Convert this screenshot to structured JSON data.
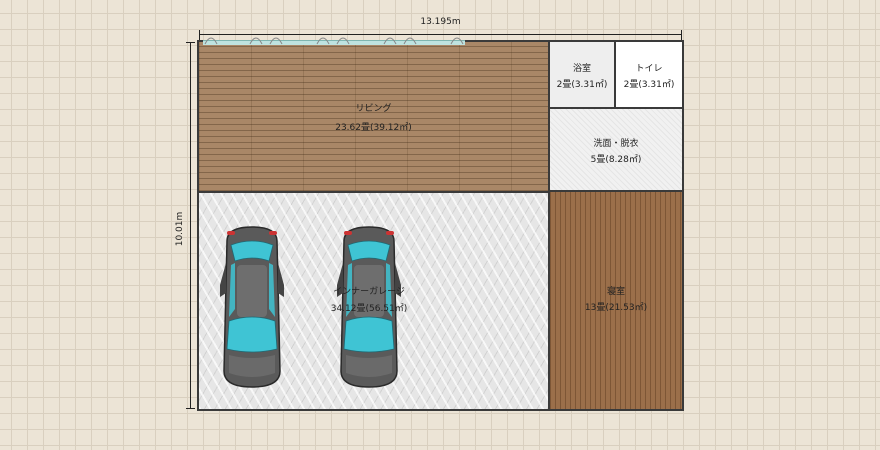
{
  "dimensions": {
    "width_label": "13.195m",
    "height_label": "10.01m"
  },
  "rooms": {
    "living": {
      "name": "リビング",
      "area": "23.62畳(39.12㎡)"
    },
    "bath": {
      "name": "浴室",
      "area": "2畳(3.31㎡)"
    },
    "toilet": {
      "name": "トイレ",
      "area": "2畳(3.31㎡)"
    },
    "washroom": {
      "name": "洗面・脱衣",
      "area": "5畳(8.28㎡)"
    },
    "garage": {
      "name": "インナーガレージ",
      "area": "34.12畳(56.51㎡)"
    },
    "bedroom": {
      "name": "寝室",
      "area": "13畳(21.53㎡)"
    }
  },
  "colors": {
    "wall": "#3a3a3a",
    "living_floor": "#a98767",
    "bedroom_floor": "#9b6f4a",
    "car_glass": "#3fc4d4"
  },
  "icons": [
    "window-icon",
    "car-icon"
  ]
}
